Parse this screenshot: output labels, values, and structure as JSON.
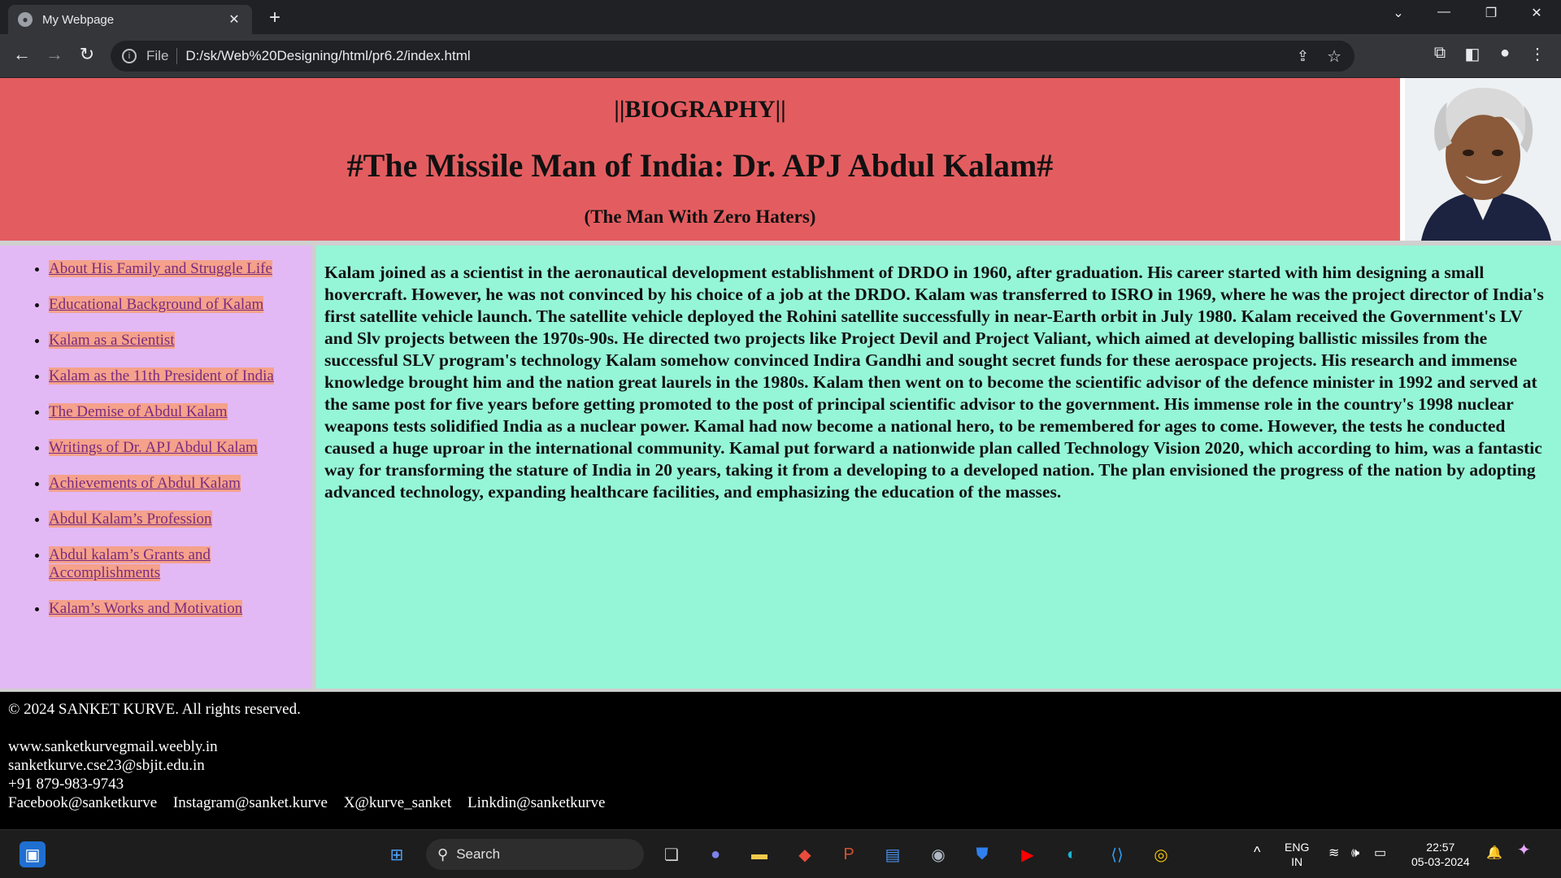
{
  "browser": {
    "tab_title": "My Webpage",
    "url_scheme": "File",
    "url": "D:/sk/Web%20Designing/html/pr6.2/index.html"
  },
  "header": {
    "kicker": "||BIOGRAPHY||",
    "title": "#The Missile Man of India: Dr. APJ Abdul Kalam#",
    "subtitle": "(The Man With Zero Haters)"
  },
  "sidebar": {
    "items": [
      "About His Family and Struggle Life",
      "Educational Background of Kalam",
      "Kalam as a Scientist",
      "Kalam as the 11th President of India",
      "The Demise of Abdul Kalam",
      "Writings of Dr. APJ Abdul Kalam",
      "Achievements of Abdul Kalam",
      "Abdul Kalam’s Profession",
      "Abdul kalam’s Grants and Accomplishments",
      "Kalam’s Works and Motivation"
    ]
  },
  "content": {
    "paragraph": "Kalam joined as a scientist in the aeronautical development establishment of DRDO in 1960, after graduation. His career started with him designing a small hovercraft. However, he was not convinced by his choice of a job at the DRDO. Kalam was transferred to ISRO in 1969, where he was the project director of India's first satellite vehicle launch. The satellite vehicle deployed the Rohini satellite successfully in near-Earth orbit in July 1980. Kalam received the Government's LV and Slv projects between the 1970s-90s. He directed two projects like Project Devil and Project Valiant, which aimed at developing ballistic missiles from the successful SLV program's technology Kalam somehow convinced Indira Gandhi and sought secret funds for these aerospace projects. His research and immense knowledge brought him and the nation great laurels in the 1980s. Kalam then went on to become the scientific advisor of the defence minister in 1992 and served at the same post for five years before getting promoted to the post of principal scientific advisor to the government. His immense role in the country's 1998 nuclear weapons tests solidified India as a nuclear power. Kamal had now become a national hero, to be remembered for ages to come. However, the tests he conducted caused a huge uproar in the international community. Kamal put forward a nationwide plan called Technology Vision 2020, which according to him, was a fantastic way for transforming the stature of India in 20 years, taking it from a developing to a developed nation. The plan envisioned the progress of the nation by adopting advanced technology, expanding healthcare facilities, and emphasizing the education of the masses."
  },
  "footer": {
    "copyright": "© 2024 SANKET KURVE. All rights reserved.",
    "website": "www.sanketkurvegmail.weebly.in",
    "email": "sanketkurve.cse23@sbjit.edu.in",
    "phone": "+91 879-983-9743",
    "socials": [
      "Facebook@sanketkurve",
      "Instagram@sanket.kurve",
      "X@kurve_sanket",
      "Linkdin@sanketkurve"
    ]
  },
  "taskbar": {
    "search_label": "Search",
    "lang": "ENG",
    "region": "IN",
    "time": "22:57",
    "date": "05-03-2024"
  },
  "colors": {
    "header_bg": "#e35d60",
    "sidebar_bg": "#e3b9f5",
    "link_bg": "#f5a18b",
    "content_bg": "#95f6d7",
    "footer_bg": "#000000"
  }
}
